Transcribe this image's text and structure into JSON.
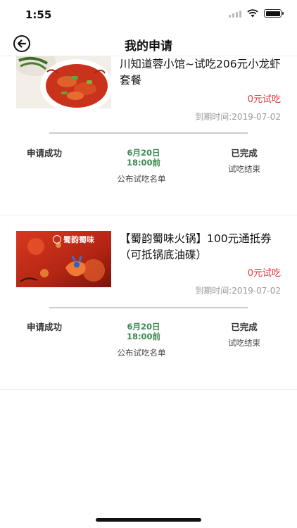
{
  "status_bar": {
    "time": "1:55"
  },
  "nav": {
    "title": "我的申请"
  },
  "applications": [
    {
      "title": "川知道蓉小馆~试吃206元小龙虾套餐",
      "price_label": "0元试吃",
      "expiry": "到期时间:2019-07-02",
      "step1_label": "申请成功",
      "step2_date": "6月20日\n18:00前",
      "step2_desc": "公布试吃名单",
      "step3_label": "已完成",
      "step3_desc": "试吃结束"
    },
    {
      "title": "【蜀韵蜀味火锅】100元通抵券（可抵锅底油碟）",
      "price_label": "0元试吃",
      "expiry": "到期时间:2019-07-02",
      "image_logo_text": "蜀韵蜀味",
      "step1_label": "申请成功",
      "step2_date": "6月20日\n18:00前",
      "step2_desc": "公布试吃名单",
      "step3_label": "已完成",
      "step3_desc": "试吃结束"
    }
  ]
}
